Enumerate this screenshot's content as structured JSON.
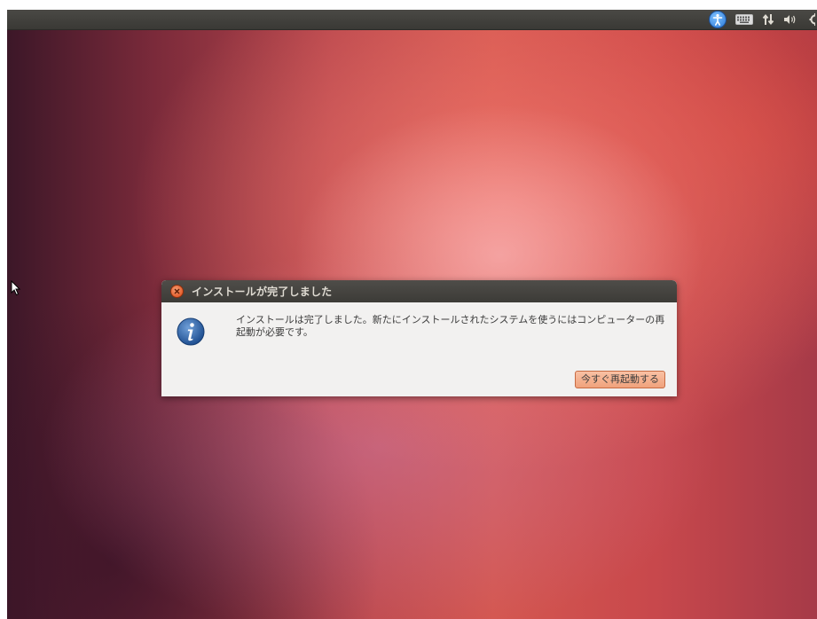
{
  "panel": {
    "indicators": [
      "accessibility-icon",
      "keyboard-icon",
      "network-icon",
      "volume-icon",
      "settings-icon"
    ]
  },
  "dialog": {
    "title": "インストールが完了しました",
    "message": "インストールは完了しました。新たにインストールされたシステムを使うにはコンピューターの再起動が必要です。",
    "restart_button": "今すぐ再起動する",
    "icon": "info-icon"
  },
  "colors": {
    "ubuntu_orange": "#dd4814",
    "panel_dark": "#3c3b37",
    "dialog_bg": "#f2f1f0",
    "button_bg": "#f0a27c"
  }
}
